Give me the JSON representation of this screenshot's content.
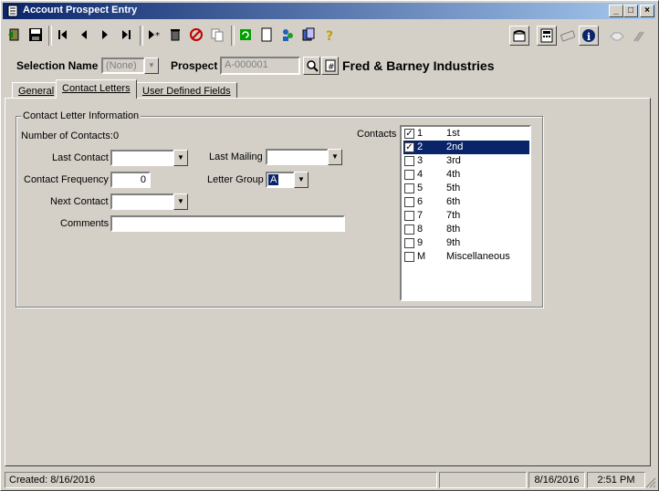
{
  "window": {
    "title": "Account Prospect Entry"
  },
  "selection": {
    "name_label": "Selection Name",
    "name_value": "(None)",
    "prospect_label": "Prospect",
    "prospect_value": "A-000001",
    "company_name": "Fred & Barney Industries"
  },
  "tabs": [
    {
      "label": "General"
    },
    {
      "label": "Contact Letters"
    },
    {
      "label": "User Defined Fields"
    }
  ],
  "contact_info": {
    "group_title": "Contact Letter Information",
    "num_contacts_label": "Number of Contacts:",
    "num_contacts_value": "0",
    "last_contact_label": "Last Contact",
    "last_contact_value": "",
    "frequency_label": "Contact Frequency",
    "frequency_value": "0",
    "next_contact_label": "Next Contact",
    "next_contact_value": "",
    "comments_label": "Comments",
    "comments_value": "",
    "last_mailing_label": "Last Mailing",
    "last_mailing_value": "",
    "letter_group_label": "Letter Group",
    "letter_group_value": "A",
    "contacts_label": "Contacts"
  },
  "contacts": [
    {
      "code": "1",
      "name": "1st",
      "checked": true,
      "selected": false
    },
    {
      "code": "2",
      "name": "2nd",
      "checked": true,
      "selected": true
    },
    {
      "code": "3",
      "name": "3rd",
      "checked": false,
      "selected": false
    },
    {
      "code": "4",
      "name": "4th",
      "checked": false,
      "selected": false
    },
    {
      "code": "5",
      "name": "5th",
      "checked": false,
      "selected": false
    },
    {
      "code": "6",
      "name": "6th",
      "checked": false,
      "selected": false
    },
    {
      "code": "7",
      "name": "7th",
      "checked": false,
      "selected": false
    },
    {
      "code": "8",
      "name": "8th",
      "checked": false,
      "selected": false
    },
    {
      "code": "9",
      "name": "9th",
      "checked": false,
      "selected": false
    },
    {
      "code": "M",
      "name": "Miscellaneous",
      "checked": false,
      "selected": false
    }
  ],
  "status": {
    "created": "Created: 8/16/2016",
    "date": "8/16/2016",
    "time": "2:51 PM"
  },
  "colors": {
    "title_start": "#0a246a",
    "title_end": "#a6caf0",
    "selection": "#0a246a",
    "face": "#d4d0c8"
  }
}
